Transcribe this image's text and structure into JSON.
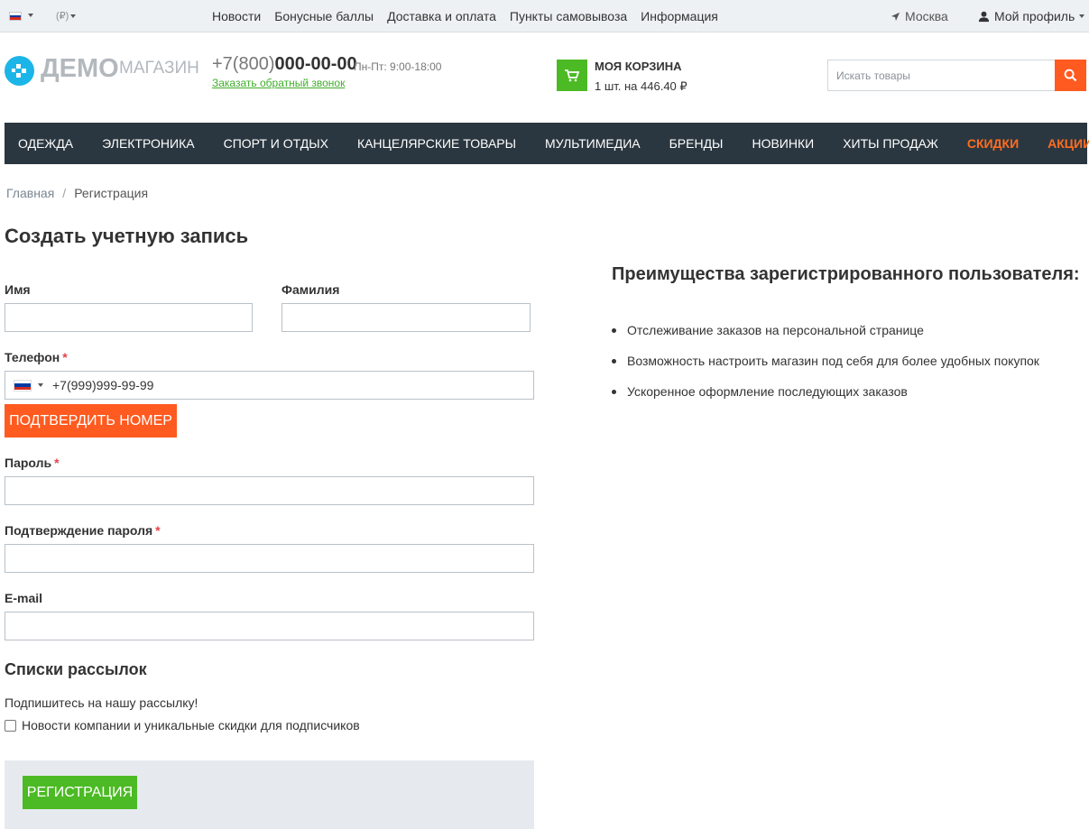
{
  "topbar": {
    "flag": {
      "colors": [
        "#ffffff",
        "#0039a6",
        "#d52b1e"
      ]
    },
    "currency": "(₽)",
    "links": [
      "Новости",
      "Бонусные баллы",
      "Доставка и оплата",
      "Пункты самовывоза",
      "Информация"
    ],
    "city": "Москва",
    "profile": "Мой профиль"
  },
  "header": {
    "logo_main": "ДЕМО",
    "logo_sub": "МАГАЗИН",
    "phone_prefix": "+7(800)",
    "phone_number": "000-00-00",
    "phone_hours": "Пн-Пт: 9:00-18:00",
    "callback_link": "Заказать обратный звонок",
    "cart": {
      "title": "Моя корзина",
      "summary": "1 шт. на 446.40 ₽"
    },
    "search": {
      "placeholder": "Искать товары",
      "icon": "search-icon"
    }
  },
  "nav": {
    "items": [
      "ОДЕЖДА",
      "ЭЛЕКТРОНИКА",
      "СПОРТ И ОТДЫХ",
      "КАНЦЕЛЯРСКИЕ ТОВАРЫ",
      "МУЛЬТИМЕДИА",
      "БРЕНДЫ",
      "НОВИНКИ",
      "ХИТЫ ПРОДАЖ"
    ],
    "highlighted": [
      "СКИДКИ",
      "АКЦИИ"
    ],
    "highlight_color": "#ff6d1f"
  },
  "breadcrumb": {
    "home": "Главная",
    "separator": "/",
    "current": "Регистрация"
  },
  "page_title": "Создать учетную запись",
  "form": {
    "first_name_label": "Имя",
    "last_name_label": "Фамилия",
    "phone_label": "Телефон",
    "phone_value": "+7(999)999-99-99",
    "confirm_button": "Подтвердить номер",
    "password_label": "Пароль",
    "password_confirm_label": "Подтверждение пароля",
    "email_label": "E-mail",
    "required_mark": "*"
  },
  "mailing": {
    "title": "Списки рассылок",
    "subtitle": "Подпишитесь на нашу рассылку!",
    "checkbox_label": "Новости компании и уникальные скидки для подписчиков",
    "checked": false
  },
  "submit_button": "Регистрация",
  "benefits": {
    "title": "Преимущества зарегистрированного пользователя:",
    "items": [
      "Отслеживание заказов на персональной странице",
      "Возможность настроить магазин под себя для более удобных покупок",
      "Ускоренное оформление последующих заказов"
    ]
  },
  "colors": {
    "accent_orange": "#ff5a1f",
    "accent_green": "#4cba24",
    "nav_bg": "#2b3740",
    "logo_blue": "#1cb5e8"
  }
}
